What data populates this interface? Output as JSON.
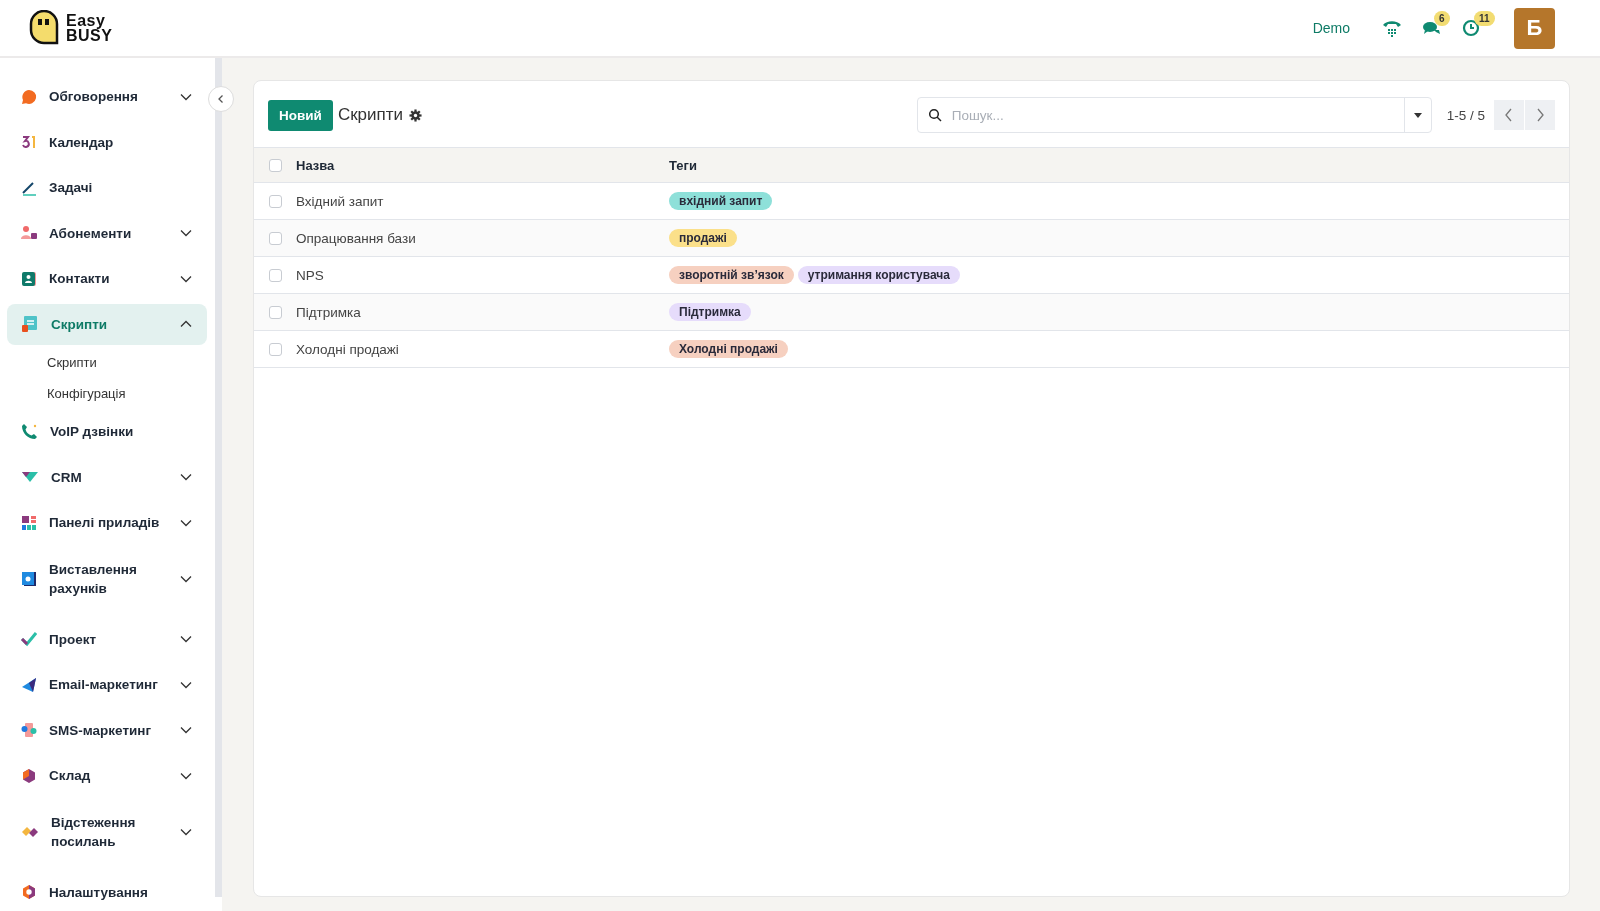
{
  "header": {
    "logo_text": [
      "Easy",
      "BUSY"
    ],
    "user_label": "Demo",
    "messages_badge": "6",
    "activities_badge": "11",
    "avatar": "Б"
  },
  "sidebar": {
    "items": [
      {
        "label": "Обговорення",
        "kind": "group",
        "expanded": false,
        "selected": false
      },
      {
        "label": "Календар",
        "kind": "link",
        "selected": false
      },
      {
        "label": "Задачі",
        "kind": "link",
        "selected": false
      },
      {
        "label": "Абонементи",
        "kind": "group",
        "expanded": false,
        "selected": false
      },
      {
        "label": "Контакти",
        "kind": "group",
        "expanded": false,
        "selected": false
      },
      {
        "label": "Скрипти",
        "kind": "group",
        "expanded": true,
        "selected": true,
        "children": [
          {
            "label": "Скрипти"
          },
          {
            "label": "Конфігурація"
          }
        ]
      },
      {
        "label": "VoIP дзвінки",
        "kind": "link",
        "selected": false
      },
      {
        "label": "CRM",
        "kind": "group",
        "expanded": false,
        "selected": false
      },
      {
        "label": "Панелі приладів",
        "kind": "group",
        "expanded": false,
        "selected": false
      },
      {
        "label": "Виставлення рахунків",
        "kind": "group",
        "expanded": false,
        "selected": false
      },
      {
        "label": "Проект",
        "kind": "group",
        "expanded": false,
        "selected": false
      },
      {
        "label": "Email-маркетинг",
        "kind": "group",
        "expanded": false,
        "selected": false
      },
      {
        "label": "SMS-маркетинг",
        "kind": "group",
        "expanded": false,
        "selected": false
      },
      {
        "label": "Склад",
        "kind": "group",
        "expanded": false,
        "selected": false
      },
      {
        "label": "Відстеження посилань",
        "kind": "group",
        "expanded": false,
        "selected": false
      },
      {
        "label": "Налаштування",
        "kind": "link",
        "selected": false
      }
    ]
  },
  "control_panel": {
    "new_button": "Новий",
    "title": "Скрипти",
    "search": {
      "placeholder": "Пошук..."
    },
    "pager": "1-5 / 5"
  },
  "table": {
    "columns": [
      "Назва",
      "Теги"
    ],
    "all_checked": false,
    "rows": [
      {
        "name": "Вхідний запит",
        "checked": false,
        "tags": [
          {
            "label": "вхідний запит",
            "color": "#8ee0d9"
          }
        ]
      },
      {
        "name": "Опрацювання бази",
        "checked": false,
        "tags": [
          {
            "label": "продажі",
            "color": "#fbe08a"
          }
        ]
      },
      {
        "name": "NPS",
        "checked": false,
        "tags": [
          {
            "label": "зворотній зв’язок",
            "color": "#f6d0c0"
          },
          {
            "label": "утримання користувача",
            "color": "#e6dcfb"
          }
        ]
      },
      {
        "name": "Підтримка",
        "checked": false,
        "tags": [
          {
            "label": "Підтримка",
            "color": "#e6dcfb"
          }
        ]
      },
      {
        "name": "Холодні продажі",
        "checked": false,
        "tags": [
          {
            "label": "Холодні продажі",
            "color": "#f6d0c0"
          }
        ]
      }
    ]
  }
}
